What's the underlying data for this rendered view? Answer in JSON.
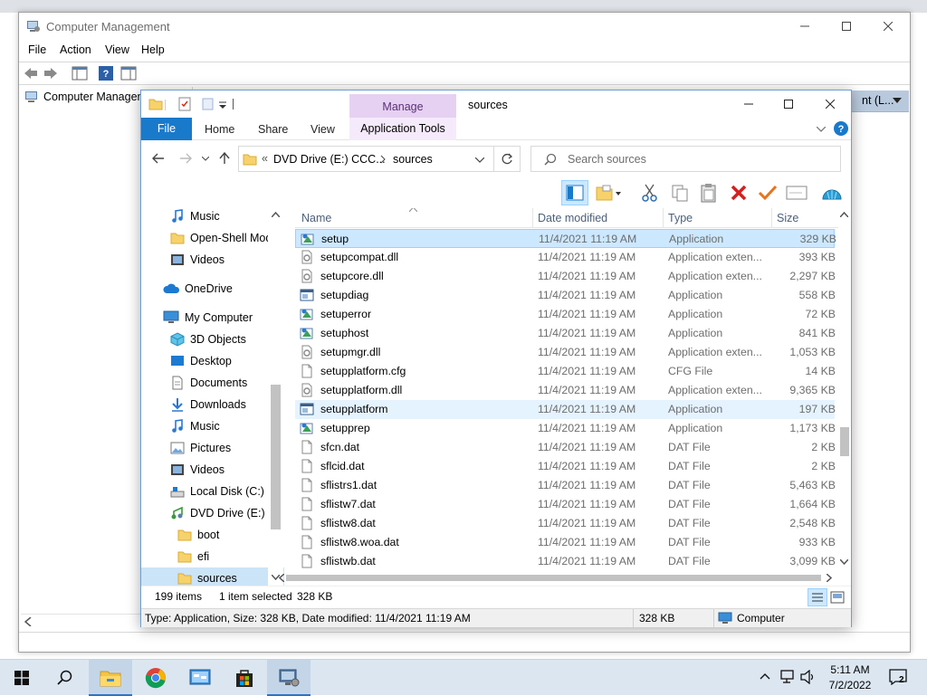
{
  "background": {
    "cm_window": {
      "title": "Computer Management",
      "menu": [
        "File",
        "Action",
        "View",
        "Help"
      ],
      "tree_root": "Computer Managem",
      "right_pane_header": "nt (L..."
    }
  },
  "explorer": {
    "title": "sources",
    "contextual_group": "Manage",
    "ribbon_tabs": [
      "File",
      "Home",
      "Share",
      "View",
      "Application Tools"
    ],
    "address": {
      "prefix": "«",
      "segments": [
        "DVD Drive (E:) CCC...",
        "sources"
      ]
    },
    "search_placeholder": "Search sources",
    "nav": [
      {
        "label": "Music",
        "icon": "music-icon",
        "indent": 1
      },
      {
        "label": "Open-Shell Mod",
        "icon": "folder-icon",
        "indent": 1
      },
      {
        "label": "Videos",
        "icon": "videos-icon",
        "indent": 1
      },
      {
        "label": "OneDrive",
        "icon": "onedrive-icon",
        "indent": 0
      },
      {
        "label": "My Computer",
        "icon": "computer-icon",
        "indent": 0
      },
      {
        "label": "3D Objects",
        "icon": "3d-objects-icon",
        "indent": 1
      },
      {
        "label": "Desktop",
        "icon": "desktop-icon",
        "indent": 1
      },
      {
        "label": "Documents",
        "icon": "documents-icon",
        "indent": 1
      },
      {
        "label": "Downloads",
        "icon": "downloads-icon",
        "indent": 1
      },
      {
        "label": "Music",
        "icon": "music-icon",
        "indent": 1
      },
      {
        "label": "Pictures",
        "icon": "pictures-icon",
        "indent": 1
      },
      {
        "label": "Videos",
        "icon": "videos-icon",
        "indent": 1
      },
      {
        "label": "Local Disk (C:)",
        "icon": "local-disk-icon",
        "indent": 1
      },
      {
        "label": "DVD Drive (E:) C(",
        "icon": "dvd-drive-icon",
        "indent": 1
      },
      {
        "label": "boot",
        "icon": "folder-icon",
        "indent": 2
      },
      {
        "label": "efi",
        "icon": "folder-icon",
        "indent": 2
      },
      {
        "label": "sources",
        "icon": "folder-icon",
        "indent": 2,
        "selected": true
      }
    ],
    "columns": {
      "name": "Name",
      "date": "Date modified",
      "type": "Type",
      "size": "Size"
    },
    "files": [
      {
        "name": "setup",
        "date": "11/4/2021 11:19 AM",
        "type": "Application",
        "size": "329 KB",
        "icon": "setup-app-icon",
        "state": "selected"
      },
      {
        "name": "setupcompat.dll",
        "date": "11/4/2021 11:19 AM",
        "type": "Application exten...",
        "size": "393 KB",
        "icon": "dll-icon"
      },
      {
        "name": "setupcore.dll",
        "date": "11/4/2021 11:19 AM",
        "type": "Application exten...",
        "size": "2,297 KB",
        "icon": "dll-icon"
      },
      {
        "name": "setupdiag",
        "date": "11/4/2021 11:19 AM",
        "type": "Application",
        "size": "558 KB",
        "icon": "exe-window-icon"
      },
      {
        "name": "setuperror",
        "date": "11/4/2021 11:19 AM",
        "type": "Application",
        "size": "72 KB",
        "icon": "setup-app-icon"
      },
      {
        "name": "setuphost",
        "date": "11/4/2021 11:19 AM",
        "type": "Application",
        "size": "841 KB",
        "icon": "setup-app-icon"
      },
      {
        "name": "setupmgr.dll",
        "date": "11/4/2021 11:19 AM",
        "type": "Application exten...",
        "size": "1,053 KB",
        "icon": "dll-icon"
      },
      {
        "name": "setupplatform.cfg",
        "date": "11/4/2021 11:19 AM",
        "type": "CFG File",
        "size": "14 KB",
        "icon": "file-icon"
      },
      {
        "name": "setupplatform.dll",
        "date": "11/4/2021 11:19 AM",
        "type": "Application exten...",
        "size": "9,365 KB",
        "icon": "dll-icon"
      },
      {
        "name": "setupplatform",
        "date": "11/4/2021 11:19 AM",
        "type": "Application",
        "size": "197 KB",
        "icon": "exe-window-icon",
        "state": "hover"
      },
      {
        "name": "setupprep",
        "date": "11/4/2021 11:19 AM",
        "type": "Application",
        "size": "1,173 KB",
        "icon": "setup-app-icon"
      },
      {
        "name": "sfcn.dat",
        "date": "11/4/2021 11:19 AM",
        "type": "DAT File",
        "size": "2 KB",
        "icon": "file-icon"
      },
      {
        "name": "sflcid.dat",
        "date": "11/4/2021 11:19 AM",
        "type": "DAT File",
        "size": "2 KB",
        "icon": "file-icon"
      },
      {
        "name": "sflistrs1.dat",
        "date": "11/4/2021 11:19 AM",
        "type": "DAT File",
        "size": "5,463 KB",
        "icon": "file-icon"
      },
      {
        "name": "sflistw7.dat",
        "date": "11/4/2021 11:19 AM",
        "type": "DAT File",
        "size": "1,664 KB",
        "icon": "file-icon"
      },
      {
        "name": "sflistw8.dat",
        "date": "11/4/2021 11:19 AM",
        "type": "DAT File",
        "size": "2,548 KB",
        "icon": "file-icon"
      },
      {
        "name": "sflistw8.woa.dat",
        "date": "11/4/2021 11:19 AM",
        "type": "DAT File",
        "size": "933 KB",
        "icon": "file-icon"
      },
      {
        "name": "sflistwb.dat",
        "date": "11/4/2021 11:19 AM",
        "type": "DAT File",
        "size": "3,099 KB",
        "icon": "file-icon"
      }
    ],
    "item_count": "199 items",
    "selection": "1 item selected",
    "selection_size": "328 KB",
    "status": {
      "detail": "Type: Application, Size: 328 KB, Date modified: 11/4/2021 11:19 AM",
      "size": "328 KB",
      "location": "Computer"
    }
  },
  "taskbar": {
    "apps": [
      "start-icon",
      "search-icon",
      "file-explorer-icon",
      "chrome-icon",
      "control-panel-icon",
      "store-icon",
      "computer-management-icon"
    ],
    "time": "5:11 AM",
    "date": "7/2/2022",
    "notifications": "2"
  },
  "colors": {
    "accent": "#1979ca",
    "selection": "#cce8ff",
    "manage_tab": "#e6d1f2",
    "taskbar": "#dbe6f1"
  }
}
